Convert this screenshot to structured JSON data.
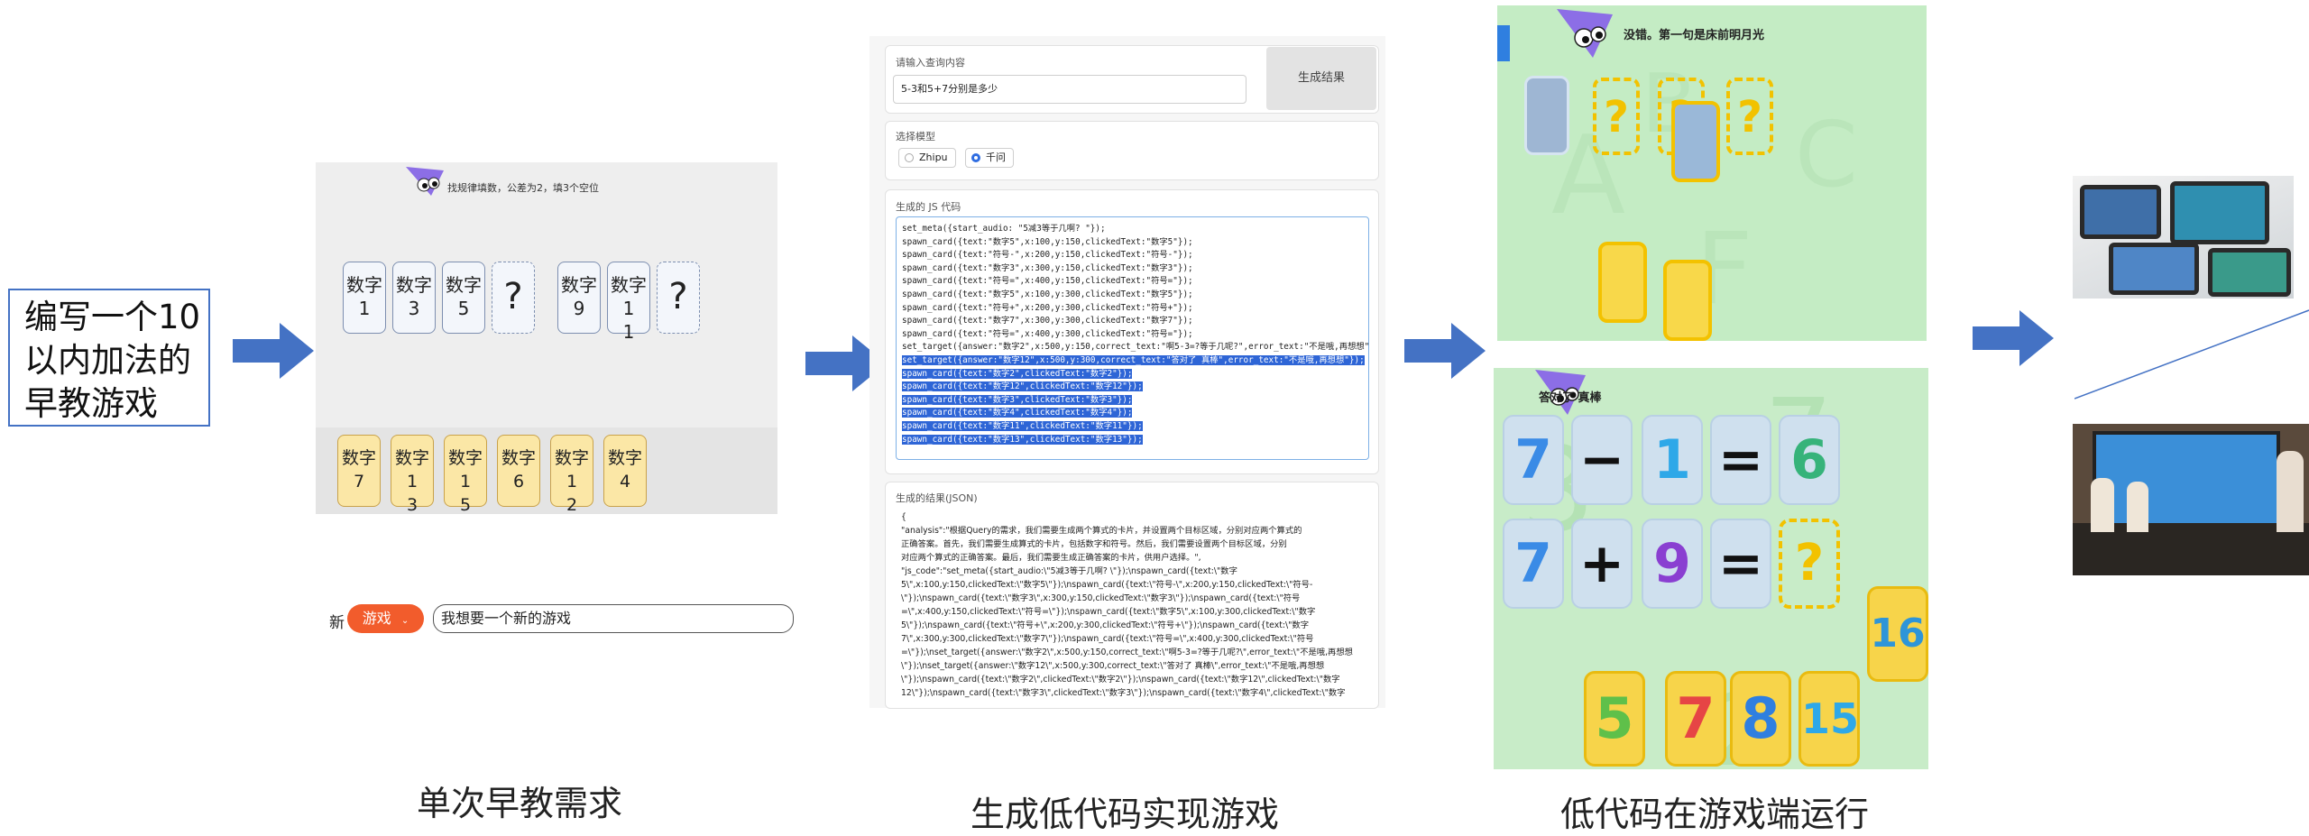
{
  "request_box": {
    "text": "编写一个10以内加法的早教游戏"
  },
  "captions": {
    "step1": "单次早教需求",
    "step2": "生成低代码实现游戏",
    "step3": "低代码在游戏端运行"
  },
  "panel1": {
    "hint": "找规律填数，公差为2，填3个空位",
    "top_cards": [
      {
        "line1": "数字",
        "line2": "1"
      },
      {
        "line1": "数字",
        "line2": "3"
      },
      {
        "line1": "数字",
        "line2": "5"
      },
      {
        "line1": "?",
        "line2": ""
      },
      {
        "line1": "数字",
        "line2": "9"
      },
      {
        "line1": "数字1",
        "line2": "1"
      },
      {
        "line1": "?",
        "line2": ""
      }
    ],
    "bottom_cards": [
      {
        "line1": "数字",
        "line2": "7"
      },
      {
        "line1": "数字1",
        "line2": "3"
      },
      {
        "line1": "数字1",
        "line2": "5"
      },
      {
        "line1": "数字",
        "line2": "6"
      },
      {
        "line1": "数字1",
        "line2": "2"
      },
      {
        "line1": "数字",
        "line2": "4"
      }
    ],
    "new_label": "新",
    "game_pill": "游戏",
    "chat_input": "我想要一个新的游戏"
  },
  "panel2": {
    "query_label": "请输入查询内容",
    "query_value": "5-3和5+7分别是多少",
    "generate_button": "生成结果",
    "model_label": "选择模型",
    "models": [
      "Zhipu",
      "千问"
    ],
    "selected_model": "千问",
    "code_label": "生成的 JS 代码",
    "code_lines": [
      "set_meta({start_audio: \"5减3等于几啊? \"});",
      "spawn_card({text:\"数字5\",x:100,y:150,clickedText:\"数字5\"});",
      "spawn_card({text:\"符号-\",x:200,y:150,clickedText:\"符号-\"});",
      "spawn_card({text:\"数字3\",x:300,y:150,clickedText:\"数字3\"});",
      "spawn_card({text:\"符号=\",x:400,y:150,clickedText:\"符号=\"});",
      "spawn_card({text:\"数字5\",x:100,y:300,clickedText:\"数字5\"});",
      "spawn_card({text:\"符号+\",x:200,y:300,clickedText:\"符号+\"});",
      "spawn_card({text:\"数字7\",x:300,y:300,clickedText:\"数字7\"});",
      "spawn_card({text:\"符号=\",x:400,y:300,clickedText:\"符号=\"});",
      "set_target({answer:\"数字2\",x:500,y:150,correct_text:\"啊5-3=?等于几呢?\",error_text:\"不是哦,再想想\"});"
    ],
    "code_lines_highlight": [
      "set_target({answer:\"数字12\",x:500,y:300,correct_text:\"答对了 真棒\",error_text:\"不是哦,再想想\"});",
      "spawn_card({text:\"数字2\",clickedText:\"数字2\"});",
      "spawn_card({text:\"数字12\",clickedText:\"数字12\"});",
      "spawn_card({text:\"数字3\",clickedText:\"数字3\"});",
      "spawn_card({text:\"数字4\",clickedText:\"数字4\"});",
      "spawn_card({text:\"数字11\",clickedText:\"数字11\"});",
      "spawn_card({text:\"数字13\",clickedText:\"数字13\"});"
    ],
    "result_label": "生成的结果(JSON)",
    "result_lines": [
      "{",
      "\"analysis\":\"根据Query的需求，我们需要生成两个算式的卡片，并设置两个目标区域，分别对应两个算式的",
      "正确答案。首先，我们需要生成算式的卡片，包括数字和符号。然后，我们需要设置两个目标区域，分别",
      "对应两个算式的正确答案。最后，我们需要生成正确答案的卡片，供用户选择。\",",
      "\"js_code\":\"set_meta({start_audio:\\\"5减3等于几啊? \\\"});\\nspawn_card({text:\\\"数字",
      "5\\\",x:100,y:150,clickedText:\\\"数字5\\\"});\\nspawn_card({text:\\\"符号-\\\",x:200,y:150,clickedText:\\\"符号-",
      "\\\"});\\nspawn_card({text:\\\"数字3\\\",x:300,y:150,clickedText:\\\"数字3\\\"});\\nspawn_card({text:\\\"符号",
      "=\\\",x:400,y:150,clickedText:\\\"符号=\\\"});\\nspawn_card({text:\\\"数字5\\\",x:100,y:300,clickedText:\\\"数字",
      "5\\\"});\\nspawn_card({text:\\\"符号+\\\",x:200,y:300,clickedText:\\\"符号+\\\"});\\nspawn_card({text:\\\"数字",
      "7\\\",x:300,y:300,clickedText:\\\"数字7\\\"});\\nspawn_card({text:\\\"符号=\\\",x:400,y:300,clickedText:\\\"符号",
      "=\\\"});\\nset_target({answer:\\\"数字2\\\",x:500,y:150,correct_text:\\\"啊5-3=?等于几呢?\\\",error_text:\\\"不是哦,再想想",
      "\\\"});\\nset_target({answer:\\\"数字12\\\",x:500,y:300,correct_text:\\\"答对了 真棒\\\",error_text:\\\"不是哦,再想想",
      "\\\"});\\nspawn_card({text:\\\"数字2\\\",clickedText:\\\"数字2\\\"});\\nspawn_card({text:\\\"数字12\\\",clickedText:\\\"数字",
      "12\\\"});\\nspawn_card({text:\\\"数字3\\\",clickedText:\\\"数字3\\\"});\\nspawn_card({text:\\\"数字4\\\",clickedText:\\\"数字"
    ]
  },
  "panel3": {
    "screen1_hint": "没错。第一句是床前明月光",
    "screen2_hint": "答对了 真棒",
    "row1": [
      "7",
      "−",
      "1",
      "=",
      "6"
    ],
    "row2": [
      "7",
      "+",
      "9",
      "=",
      "?"
    ],
    "floating_tile": "16",
    "answer_tiles": [
      "5",
      "7",
      "8",
      "15"
    ]
  },
  "colors": {
    "arrow_blue": "#4472c4",
    "pill_orange": "#f25c2c",
    "highlight_blue": "#2e65d6",
    "game_green": "#c8ecc8",
    "card_yellow": "#f7d44a"
  }
}
